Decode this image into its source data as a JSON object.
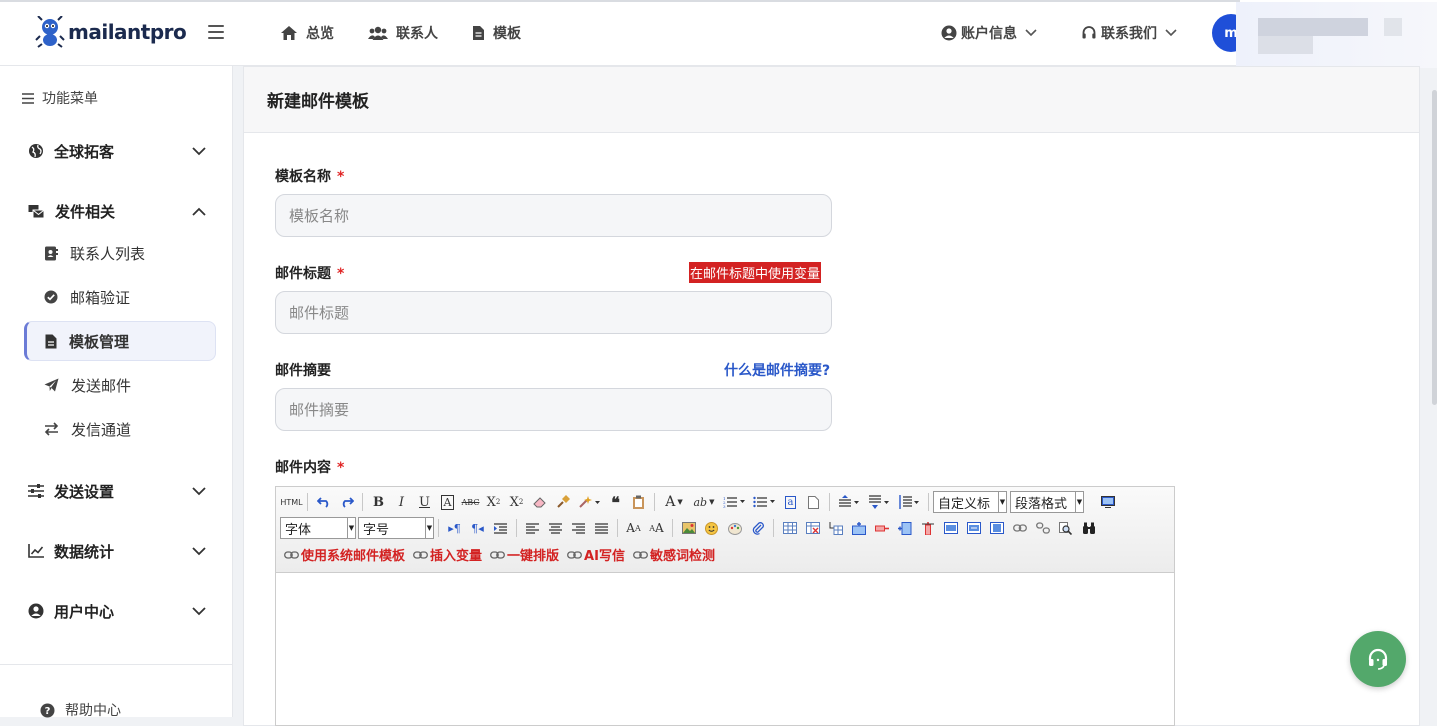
{
  "brand": {
    "name": "mailantpro"
  },
  "topnav": [
    {
      "label": "总览",
      "icon": "home-icon"
    },
    {
      "label": "联系人",
      "icon": "users-icon"
    },
    {
      "label": "模板",
      "icon": "file-icon"
    }
  ],
  "topright": {
    "account": "账户信息",
    "contact": "联系我们",
    "avatar_initial": "m"
  },
  "sidebar": {
    "title": "功能菜单",
    "groups": {
      "global": "全球拓客",
      "sending": "发件相关",
      "settings": "发送设置",
      "stats": "数据统计",
      "user": "用户中心"
    },
    "items": {
      "contacts": "联系人列表",
      "verify": "邮箱验证",
      "templates": "模板管理",
      "send": "发送邮件",
      "channel": "发信通道"
    },
    "help": "帮助中心"
  },
  "page": {
    "title": "新建邮件模板"
  },
  "form": {
    "name_label": "模板名称",
    "name_placeholder": "模板名称",
    "subject_label": "邮件标题",
    "subject_placeholder": "邮件标题",
    "subject_var_tag": "在邮件标题中使用变量",
    "summary_label": "邮件摘要",
    "summary_placeholder": "邮件摘要",
    "summary_help": "什么是邮件摘要?",
    "content_label": "邮件内容",
    "required_mark": "*"
  },
  "editor": {
    "html_btn": "HTML",
    "custom_heading": "自定义标",
    "paragraph": "段落格式",
    "font": "字体",
    "size": "字号",
    "links": {
      "system_template": "使用系统邮件模板",
      "insert_var": "插入变量",
      "auto_layout": "一键排版",
      "ai_write": "AI写信",
      "sensitive": "敏感词检测"
    }
  },
  "colors": {
    "accent": "#1f4fd8",
    "danger": "#d32222",
    "link": "#2a58c9",
    "fab": "#53a86b"
  }
}
